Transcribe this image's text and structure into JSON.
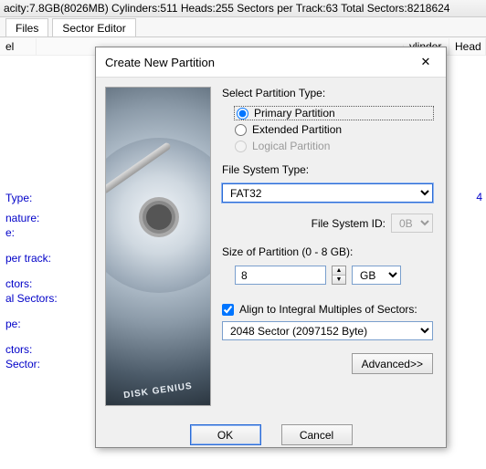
{
  "topbar": "acity:7.8GB(8026MB)  Cylinders:511  Heads:255  Sectors per Track:63  Total Sectors:8218624",
  "tabs": {
    "files": "Files",
    "sector": "Sector Editor"
  },
  "grid": {
    "col1": "el",
    "col_cylinder": "ylinder",
    "col_head": "Head"
  },
  "leftinfo": {
    "type": "Type:",
    "nature": "nature:",
    "e": "e:",
    "pertrack": "per track:",
    "ctors1": "ctors:",
    "alsectors": "al Sectors:",
    "pe": "pe:",
    "ctors2": "ctors:",
    "sector": "Sector:"
  },
  "rightval": "4",
  "dialog": {
    "title": "Create New Partition",
    "select_type": "Select Partition Type:",
    "primary": "Primary Partition",
    "extended": "Extended Partition",
    "logical": "Logical Partition",
    "fs_type": "File System Type:",
    "fs_value": "FAT32",
    "fsid_label": "File System ID:",
    "fsid_value": "0B",
    "size_label": "Size of Partition (0 - 8 GB):",
    "size_value": "8",
    "size_unit": "GB",
    "align_label": "Align to Integral Multiples of Sectors:",
    "align_value": "2048 Sector (2097152 Byte)",
    "advanced": "Advanced>>",
    "ok": "OK",
    "cancel": "Cancel"
  },
  "brand": "DISK GENIUS"
}
